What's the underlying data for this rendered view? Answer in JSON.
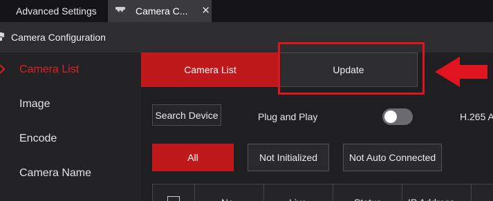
{
  "tabs": [
    {
      "label": "Advanced Settings"
    },
    {
      "label": "Camera C...",
      "close": "✕",
      "icon": "camera-icon"
    }
  ],
  "header": {
    "title": "Camera Configuration",
    "icon": "camera-icon"
  },
  "sidebar": {
    "items": [
      {
        "label": "Camera List",
        "active": true
      },
      {
        "label": "Image"
      },
      {
        "label": "Encode"
      },
      {
        "label": "Camera Name"
      }
    ]
  },
  "subtabs": [
    {
      "label": "Camera List",
      "active": true
    },
    {
      "label": "Update"
    }
  ],
  "toolbar": {
    "search_label": "Search Device",
    "plug_label": "Plug and Play",
    "plug_enabled": false,
    "h265_label": "H.265 A"
  },
  "filters": [
    {
      "label": "All",
      "active": true
    },
    {
      "label": "Not Initialized"
    },
    {
      "label": "Not Auto Connected"
    }
  ],
  "table": {
    "columns": [
      "No.",
      "Live",
      "Status",
      "IP Address"
    ]
  },
  "colors": {
    "accent": "#c0191b",
    "annotation": "#e0141e"
  }
}
